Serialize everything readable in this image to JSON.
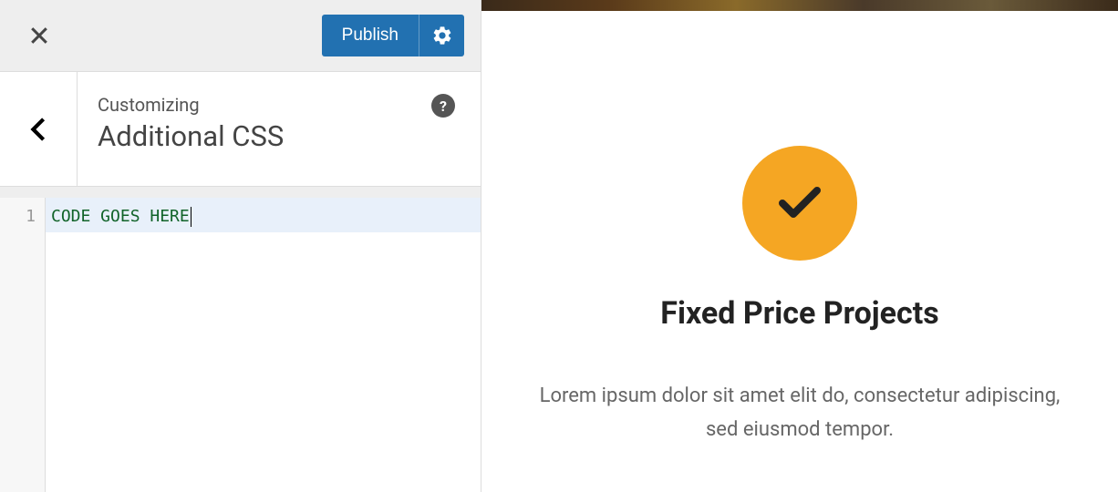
{
  "toolbar": {
    "publish_label": "Publish"
  },
  "header": {
    "breadcrumb": "Customizing",
    "title": "Additional CSS"
  },
  "editor": {
    "line_number": "1",
    "line_content": "CODE GOES HERE"
  },
  "preview": {
    "feature_title": "Fixed Price Projects",
    "feature_desc": "Lorem ipsum dolor sit amet elit do, consectetur adipiscing, sed eiusmod tempor."
  }
}
